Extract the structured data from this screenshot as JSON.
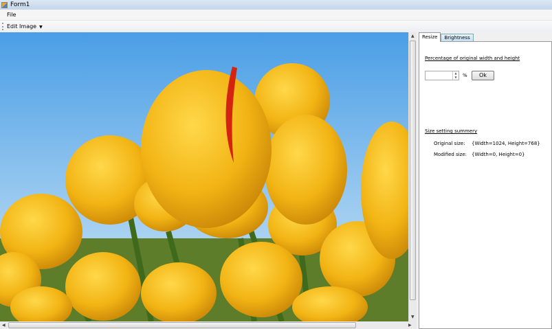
{
  "window": {
    "title": "Form1"
  },
  "menu": {
    "file": "File"
  },
  "toolbar": {
    "edit_image": "Edit Image"
  },
  "tabs": [
    {
      "label": "Resize",
      "active": true
    },
    {
      "label": "Brightness",
      "active": false
    }
  ],
  "resize": {
    "heading": "Percentage of original width and height",
    "percent_value": "",
    "percent_symbol": "%",
    "ok_label": "Ok"
  },
  "summary": {
    "heading": "Size setting summery",
    "original_label": "Original size:",
    "original_value": "{Width=1024, Height=768}",
    "modified_label": "Modified size:",
    "modified_value": "{Width=0, Height=0}"
  }
}
